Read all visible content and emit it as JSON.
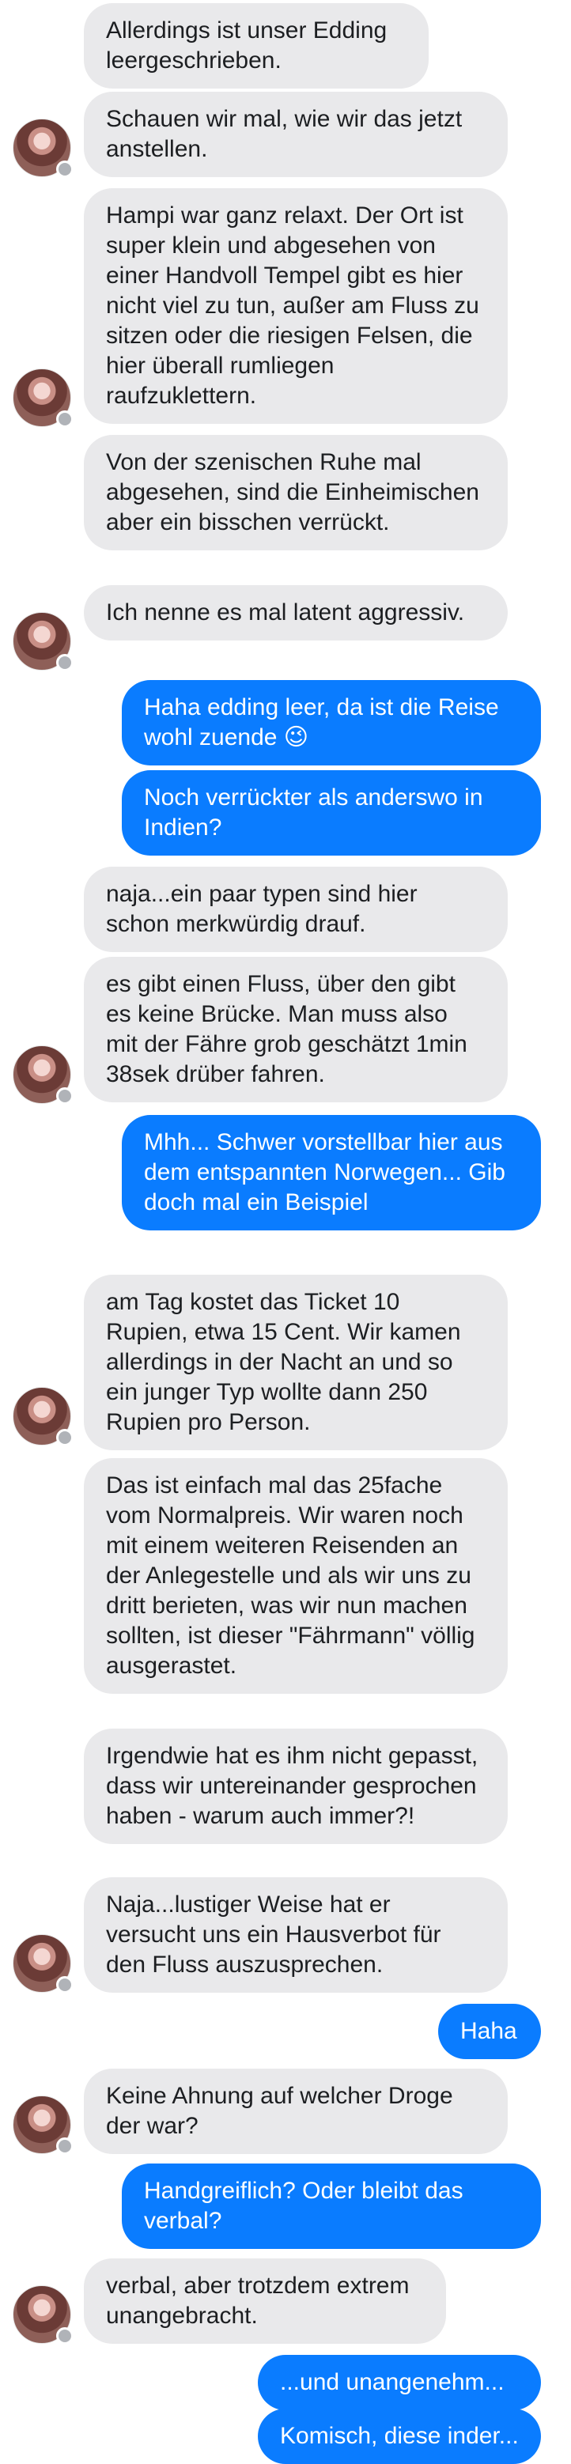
{
  "messages": [
    {
      "text": "Allerdings ist unser Edding leergeschrieben."
    },
    {
      "text": "Schauen wir mal, wie wir das jetzt anstellen."
    },
    {
      "text": "Hampi war ganz relaxt. Der Ort ist super klein und abgesehen von einer Handvoll Tempel gibt es hier nicht viel zu tun, außer am Fluss zu sitzen oder die riesigen Felsen, die hier überall rumliegen raufzuklettern."
    },
    {
      "text": "Von der szenischen Ruhe mal abgesehen, sind die Einheimischen aber ein bisschen verrückt."
    },
    {
      "text": "Ich nenne es mal latent aggressiv."
    },
    {
      "text": "Haha edding leer, da ist die Reise wohl zuende 😉"
    },
    {
      "text": "Noch verrückter als anderswo in Indien?"
    },
    {
      "text": "naja...ein paar typen sind hier schon merkwürdig drauf."
    },
    {
      "text": "es gibt einen Fluss, über den gibt es keine Brücke. Man muss also mit der Fähre grob geschätzt 1min 38sek drüber fahren."
    },
    {
      "text": "Mhh... Schwer vorstellbar hier aus dem entspannten Norwegen... Gib doch mal ein Beispiel"
    },
    {
      "text": "am Tag kostet das Ticket 10 Rupien, etwa 15 Cent. Wir kamen allerdings in der Nacht an und so ein junger Typ wollte dann 250 Rupien pro Person."
    },
    {
      "text": "Das ist einfach mal das 25fache vom Normalpreis. Wir waren noch mit einem weiteren Reisenden an der Anlegestelle und als wir uns zu dritt berieten, was wir nun machen sollten, ist dieser \"Fährmann\" völlig ausgerastet."
    },
    {
      "text": "Irgendwie hat es ihm nicht gepasst, dass wir untereinander gesprochen haben - warum auch immer?!"
    },
    {
      "text": "Naja...lustiger Weise hat er versucht uns ein Hausverbot für den Fluss auszusprechen."
    },
    {
      "text": "Haha"
    },
    {
      "text": "Keine Ahnung auf welcher Droge der war?"
    },
    {
      "text": "Handgreiflich? Oder bleibt das verbal?"
    },
    {
      "text": "verbal, aber trotzdem extrem unangebracht."
    },
    {
      "text": "...und unangenehm..."
    },
    {
      "text": "Komisch, diese inder..."
    }
  ],
  "colors": {
    "incoming_bubble": "#e9e9eb",
    "outgoing_bubble": "#0a7cff",
    "incoming_text": "#1c1e21",
    "outgoing_text": "#ffffff",
    "avatar_badge": "messenger-badge-icon"
  }
}
